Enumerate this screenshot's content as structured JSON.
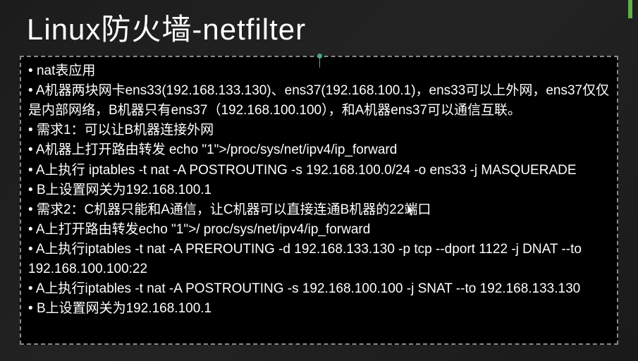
{
  "title": "Linux防火墙-netfilter",
  "bullets": [
    "nat表应用",
    "A机器两块网卡ens33(192.168.133.130)、ens37(192.168.100.1)，ens33可以上外网，ens37仅仅是内部网络，B机器只有ens37（192.168.100.100），和A机器ens37可以通信互联。",
    "需求1：可以让B机器连接外网",
    "A机器上打开路由转发 echo \"1\">/proc/sys/net/ipv4/ip_forward",
    "A上执行 iptables -t nat -A POSTROUTING -s 192.168.100.0/24 -o ens33 -j MASQUERADE",
    "B上设置网关为192.168.100.1",
    "需求2：C机器只能和A通信，让C机器可以直接连通B机器的22端口",
    "A上打开路由转发echo \"1\">/ proc/sys/net/ipv4/ip_forward",
    " A上执行iptables -t nat -A PREROUTING -d 192.168.133.130 -p tcp --dport 1122 -j DNAT --to 192.168.100.100:22",
    " A上执行iptables -t nat -A POSTROUTING -s 192.168.100.100 -j SNAT --to 192.168.133.130",
    "B上设置网关为192.168.100.1"
  ]
}
